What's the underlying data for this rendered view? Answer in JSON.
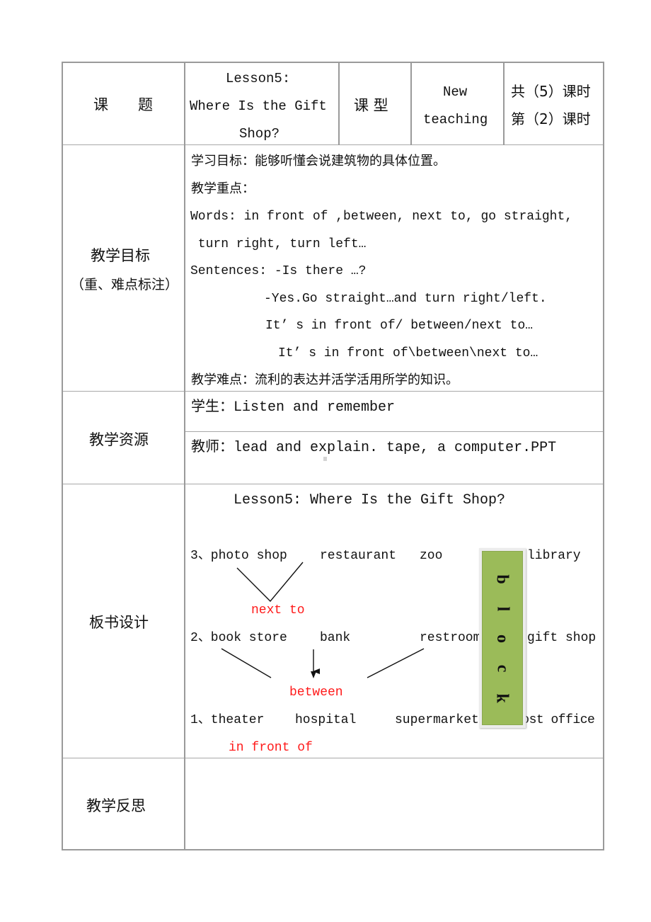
{
  "header_row": {
    "topic_label": "课　　题",
    "topic_value_lines": [
      "Lesson5:",
      "Where Is the Gift",
      "Shop?"
    ],
    "type_label": "课 型",
    "type_value_lines": [
      "New",
      "teaching"
    ],
    "period_lines": [
      "共（5）课时",
      "第（2）课时"
    ]
  },
  "objectives": {
    "label_lines": [
      "教学目标",
      "（重、难点标注）"
    ],
    "lines": [
      "学习目标：能够听懂会说建筑物的具体位置。",
      "教学重点：",
      "Words: in front of ,between, next to, go straight,",
      " turn right, turn left…",
      "Sentences: -Is there …?",
      "-Yes.Go straight…and turn right/left.",
      "It’ s in front of/ between/next to…",
      "It’ s in front of\\between\\next to…",
      "教学难点：流利的表达并活学活用所学的知识。"
    ]
  },
  "resources": {
    "label": "教学资源",
    "student": "学生：Listen and remember",
    "teacher": "教师：lead and explain. tape, a computer.PPT"
  },
  "board": {
    "label": "板书设计",
    "title": "Lesson5: Where Is the Gift Shop?",
    "row3": {
      "prefix": "3、photo shop",
      "items": [
        "restaurant",
        "zoo",
        "library"
      ]
    },
    "label_next_to": "next to",
    "row2": {
      "prefix": "2、book store",
      "items": [
        "bank",
        "restroom",
        "gift shop"
      ]
    },
    "label_between": "between",
    "row1": {
      "prefix": "1、theater",
      "items": [
        "hospital",
        "supermarket",
        "post office"
      ]
    },
    "label_in_front_of": "in front of",
    "block_letters": [
      "b",
      "l",
      "o",
      "c",
      "k"
    ],
    "colors": {
      "relation_text": "#ff1a1a",
      "block_fill": "#9bbb59"
    }
  },
  "reflection": {
    "label": "教学反思",
    "content": ""
  }
}
